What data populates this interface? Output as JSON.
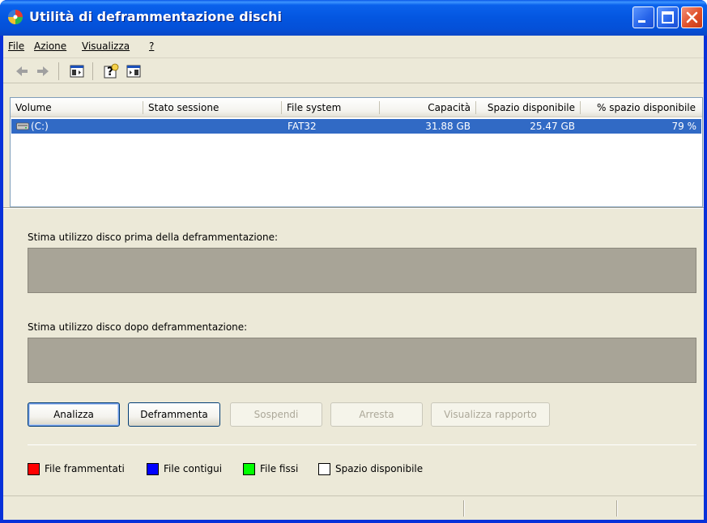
{
  "window": {
    "title": "Utilità di deframmentazione dischi",
    "titlebar_color": "#0a58e8"
  },
  "titlebar_buttons": {
    "minimize_icon": "minimize-icon",
    "maximize_icon": "maximize-icon",
    "close_icon": "close-icon"
  },
  "menu": {
    "items": [
      {
        "label": "File",
        "access_key": "F"
      },
      {
        "label": "Azione",
        "access_key": "A"
      },
      {
        "label": "Visualizza",
        "access_key": "V"
      },
      {
        "label": "?",
        "access_key": "?"
      }
    ]
  },
  "toolbar": {
    "icons": [
      "back-arrow-icon",
      "forward-arrow-icon",
      "show-hide-console-tree-icon",
      "help-icon",
      "show-hide-action-pane-icon"
    ]
  },
  "volumes": {
    "columns": [
      "Volume",
      "Stato sessione",
      "File system",
      "Capacità",
      "Spazio disponibile",
      "% spazio disponibile"
    ],
    "rows": [
      {
        "volume": "(C:)",
        "session_state": "",
        "file_system": "FAT32",
        "capacity": "31.88 GB",
        "free_space": "25.47 GB",
        "free_percent": "79 %"
      }
    ],
    "selection_color": "#316ac5"
  },
  "estimates": {
    "before_label": "Stima utilizzo disco prima della deframmentazione:",
    "after_label": "Stima utilizzo disco dopo deframmentazione:",
    "bar_color": "#a8a497"
  },
  "buttons": {
    "analyze": "Analizza",
    "defragment": "Deframmenta",
    "pause": "Sospendi",
    "stop": "Arresta",
    "view_report": "Visualizza rapporto"
  },
  "legend": {
    "items": [
      {
        "label": "File frammentati",
        "color": "#ff0000"
      },
      {
        "label": "File contigui",
        "color": "#0000ff"
      },
      {
        "label": "File fissi",
        "color": "#00ff00"
      },
      {
        "label": "Spazio disponibile",
        "color": "#ffffff"
      }
    ]
  }
}
